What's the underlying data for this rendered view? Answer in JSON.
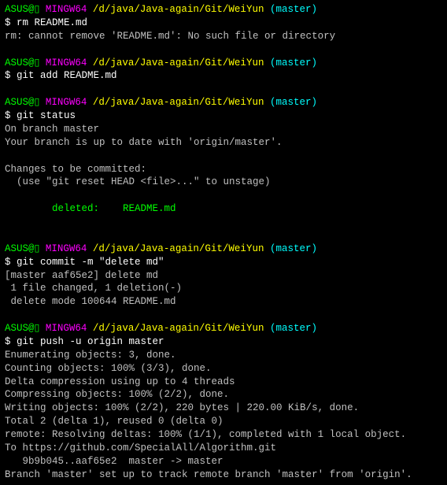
{
  "prompt": {
    "user_host": "ASUS@▯",
    "shell": " MINGW64 ",
    "path": "/d/java/Java-again/Git/WeiYun",
    "branch": " (master)",
    "dollar": "$ "
  },
  "block1": {
    "cmd": "rm README.md",
    "out1": "rm: cannot remove 'README.md': No such file or directory"
  },
  "block2": {
    "cmd": "git add README.md"
  },
  "block3": {
    "cmd": "git status",
    "out1": "On branch master",
    "out2": "Your branch is up to date with 'origin/master'.",
    "out3": "Changes to be committed:",
    "out4": "  (use \"git reset HEAD <file>...\" to unstage)",
    "out5": "        deleted:    README.md"
  },
  "block4": {
    "cmd": "git commit -m \"delete md\"",
    "out1": "[master aaf65e2] delete md",
    "out2": " 1 file changed, 1 deletion(-)",
    "out3": " delete mode 100644 README.md"
  },
  "block5": {
    "cmd": "git push -u origin master",
    "out1": "Enumerating objects: 3, done.",
    "out2": "Counting objects: 100% (3/3), done.",
    "out3": "Delta compression using up to 4 threads",
    "out4": "Compressing objects: 100% (2/2), done.",
    "out5": "Writing objects: 100% (2/2), 220 bytes | 220.00 KiB/s, done.",
    "out6": "Total 2 (delta 1), reused 0 (delta 0)",
    "out7": "remote: Resolving deltas: 100% (1/1), completed with 1 local object.",
    "out8": "To https://github.com/SpecialAll/Algorithm.git",
    "out9": "   9b9b045..aaf65e2  master -> master",
    "out10": "Branch 'master' set up to track remote branch 'master' from 'origin'."
  }
}
